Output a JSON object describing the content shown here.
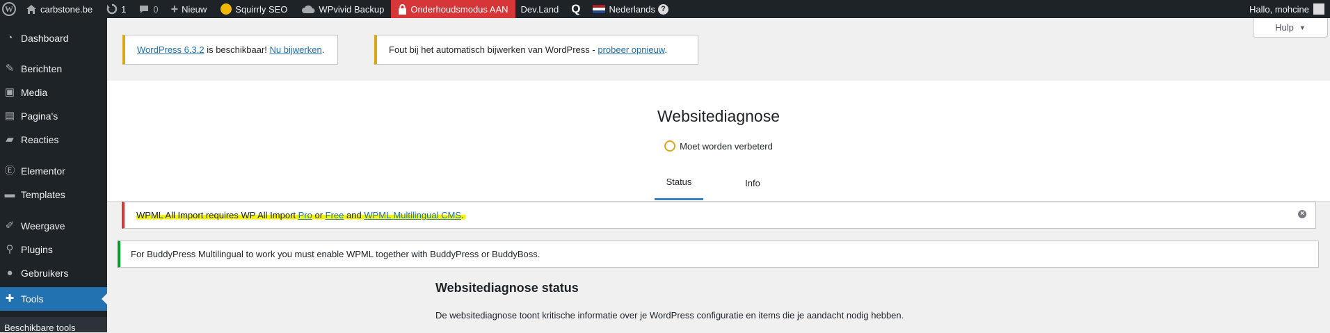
{
  "admin_bar": {
    "site_name": "carbstone.be",
    "updates_count": "1",
    "comments_count": "0",
    "new_label": "Nieuw",
    "squirrly_label": "Squirrly SEO",
    "wpvivid_label": "WPvivid Backup",
    "maintenance_label": "Onderhoudsmodus AAN",
    "devland_label": "Dev.Land",
    "language_label": "Nederlands",
    "help_glyph": "?",
    "greeting": "Hallo, mohcine",
    "icons": [
      "wordpress-logo-icon",
      "home-icon",
      "updates-icon",
      "comment-icon",
      "plus-icon",
      "squirrly-icon",
      "cloud-icon",
      "lock-icon",
      "q-icon",
      "flag-nl-icon",
      "avatar-icon"
    ],
    "maintenance_color": "#d63638"
  },
  "sidebar": {
    "items": [
      {
        "label": "Dashboard",
        "icon": "dashboard-icon"
      },
      {
        "label": "Berichten",
        "icon": "pin-icon"
      },
      {
        "label": "Media",
        "icon": "media-icon"
      },
      {
        "label": "Pagina's",
        "icon": "pages-icon"
      },
      {
        "label": "Reacties",
        "icon": "comments-icon"
      },
      {
        "label": "Elementor",
        "icon": "elementor-icon"
      },
      {
        "label": "Templates",
        "icon": "folder-icon"
      },
      {
        "label": "Weergave",
        "icon": "brush-icon"
      },
      {
        "label": "Plugins",
        "icon": "plugin-icon"
      },
      {
        "label": "Gebruikers",
        "icon": "users-icon"
      },
      {
        "label": "Tools",
        "icon": "wrench-icon"
      }
    ],
    "current": "Tools",
    "submenu_label": "Beschikbare tools"
  },
  "help_button": {
    "label": "Hulp",
    "caret": "▼"
  },
  "notices": {
    "update": {
      "link_version": "WordPress 6.3.2",
      "text_mid": " is beschikbaar! ",
      "link_update": "Nu bijwerken",
      "text_end": "."
    },
    "auto_update_error": {
      "text": "Fout bij het automatisch bijwerken van WordPress - ",
      "link": "probeer opnieuw",
      "text_end": "."
    },
    "wpml_import": {
      "text_start": "WPML All Import requires WP All Import ",
      "link_pro": "Pro",
      "text_or": " or ",
      "link_free": "Free",
      "text_and": " and ",
      "link_wpml": "WPML Multilingual CMS",
      "text_end": ".",
      "dismiss_glyph": "×"
    },
    "buddypress": {
      "text": "For BuddyPress Multilingual to work you must enable WPML together with BuddyPress or BuddyBoss."
    }
  },
  "health": {
    "title": "Websitediagnose",
    "status_text": "Moet worden verbeterd",
    "tabs": [
      {
        "label": "Status"
      },
      {
        "label": "Info"
      }
    ],
    "active_tab": "Status",
    "status_color": "#dba617"
  },
  "section": {
    "title": "Websitediagnose status",
    "description": "De websitediagnose toont kritische informatie over je WordPress configuratie en items die je aandacht nodig hebben."
  }
}
